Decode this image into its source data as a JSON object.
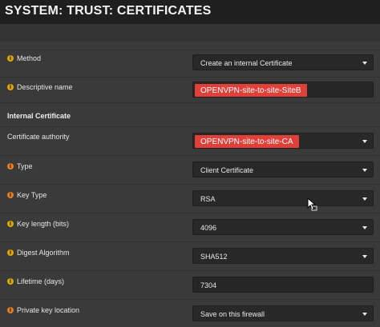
{
  "page": {
    "title": "SYSTEM: TRUST: CERTIFICATES"
  },
  "form": {
    "method": {
      "label": "Method",
      "value": "Create an internal Certificate"
    },
    "descriptive_name": {
      "label": "Descriptive name",
      "value": "OPENVPN-site-to-site-SiteB"
    },
    "section_internal": "Internal Certificate",
    "certificate_authority": {
      "label": "Certificate authority",
      "value": "OPENVPN-site-to-site-CA"
    },
    "type": {
      "label": "Type",
      "value": "Client Certificate"
    },
    "key_type": {
      "label": "Key Type",
      "value": "RSA"
    },
    "key_length": {
      "label": "Key length (bits)",
      "value": "4096"
    },
    "digest": {
      "label": "Digest Algorithm",
      "value": "SHA512"
    },
    "lifetime": {
      "label": "Lifetime (days)",
      "value": "7304"
    },
    "private_key_location": {
      "label": "Private key location",
      "value": "Save on this firewall"
    }
  },
  "icons": {
    "info": "info-circle-icon",
    "dropdown": "caret-down-icon",
    "cursor": "mouse-pointer-icon"
  },
  "colors": {
    "highlight": "#e0403a",
    "info_yellow": "#e0a800",
    "info_orange": "#e67e22"
  }
}
